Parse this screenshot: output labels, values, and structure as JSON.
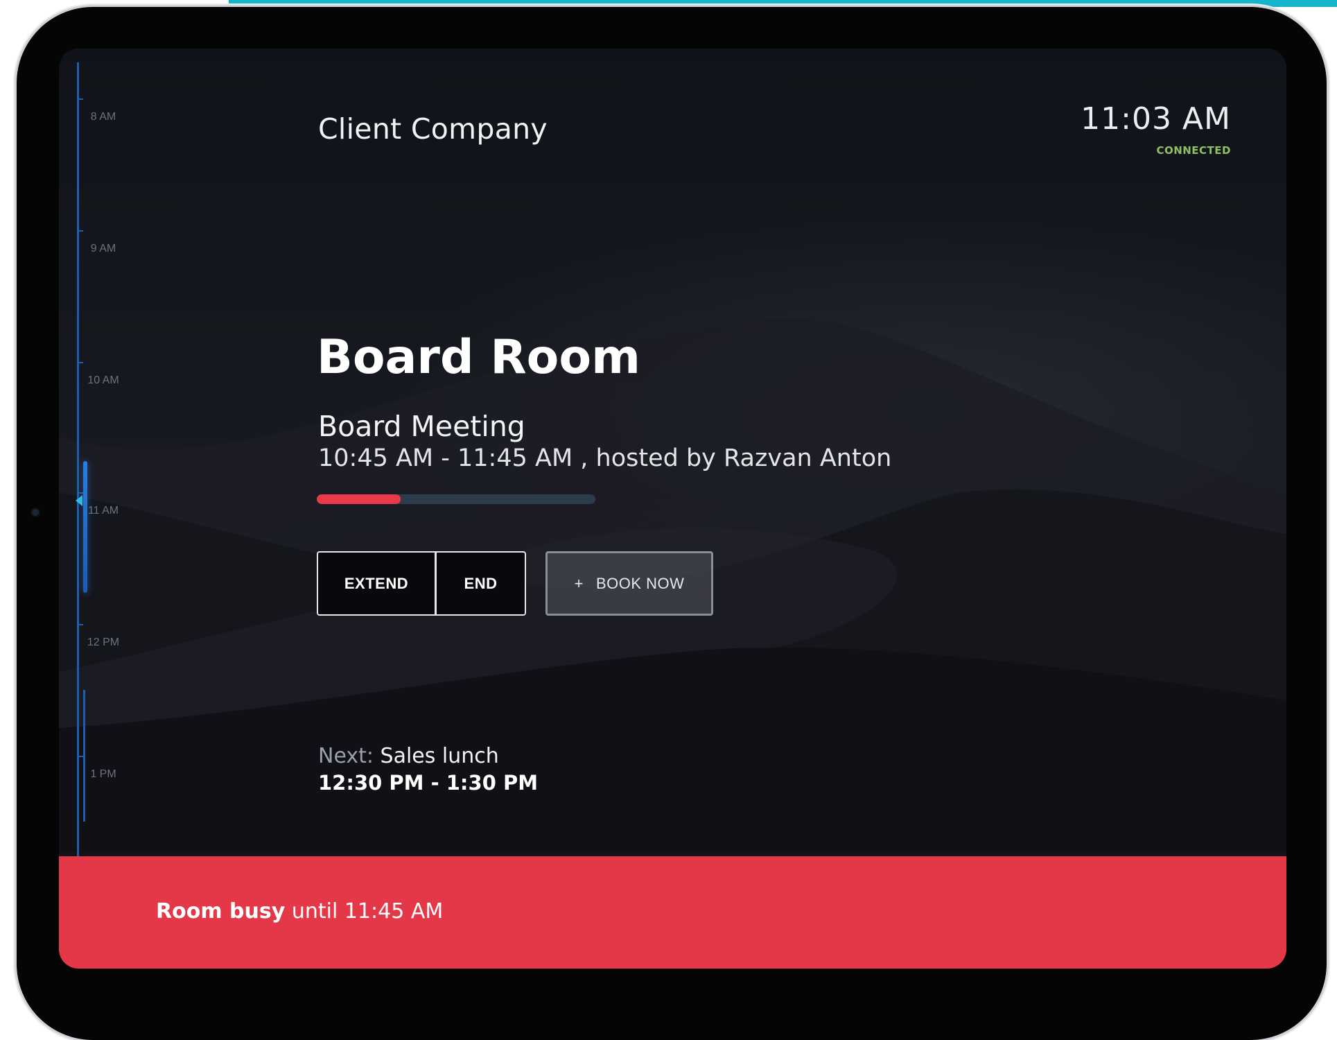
{
  "header": {
    "company": "Client Company",
    "clock": "11:03 AM",
    "status": "CONNECTED"
  },
  "timeline": {
    "labels": [
      "8 AM",
      "9 AM",
      "10 AM",
      "11 AM",
      "12 PM",
      "1 PM"
    ]
  },
  "room": {
    "name": "Board Room"
  },
  "current_meeting": {
    "title": "Board Meeting",
    "time_host": "10:45 AM - 11:45 AM , hosted by Razvan Anton",
    "progress": 0.3
  },
  "actions": {
    "extend_label": "EXTEND",
    "end_label": "END",
    "book_icon": "plus-icon",
    "book_label": "BOOK NOW"
  },
  "next_meeting": {
    "label": "Next:",
    "title": "Sales lunch",
    "time": "12:30 PM - 1:30 PM"
  },
  "banner": {
    "status_strong": "Room busy",
    "status_rest": "until 11:45 AM"
  },
  "colors": {
    "busy": "#e43848",
    "connected": "#8ec063",
    "timeline": "#1c5fae",
    "progress": "#ea3a4a",
    "backdrop": "#14b4cc"
  }
}
